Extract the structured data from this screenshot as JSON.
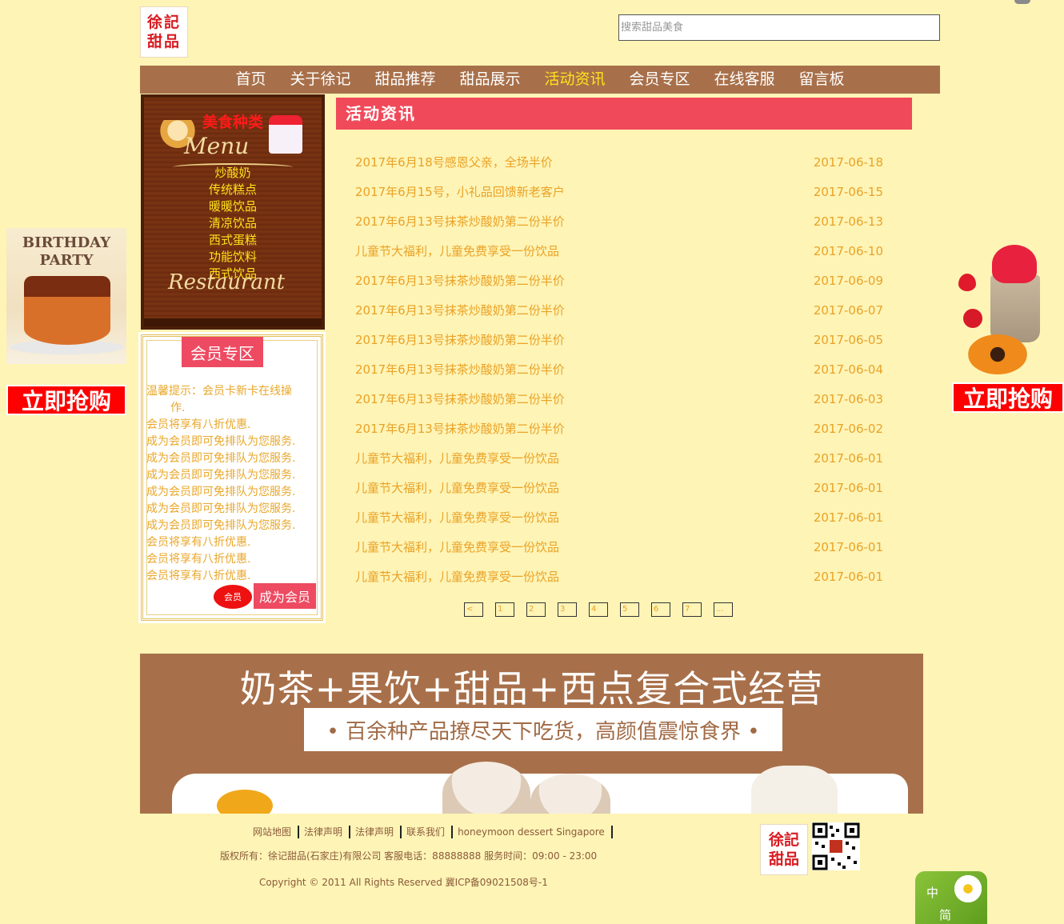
{
  "brand": {
    "logo_text": "徐记甜品"
  },
  "search": {
    "placeholder": "搜索甜品美食"
  },
  "nav": {
    "items": [
      {
        "label": "首页",
        "active": false
      },
      {
        "label": "关于徐记",
        "active": false
      },
      {
        "label": "甜品推荐",
        "active": false
      },
      {
        "label": "甜品展示",
        "active": false
      },
      {
        "label": "活动资讯",
        "active": true
      },
      {
        "label": "会员专区",
        "active": false
      },
      {
        "label": "在线客服",
        "active": false
      },
      {
        "label": "留言板",
        "active": false
      }
    ]
  },
  "menu_board": {
    "title": "美食种类",
    "script_top": "Menu",
    "script_bottom": "Restaurant",
    "items": [
      "炒酸奶",
      "传统糕点",
      "暖暖饮品",
      "清凉饮品",
      "西式蛋糕",
      "功能饮料",
      "西式饮品"
    ]
  },
  "member": {
    "title": "会员专区",
    "lines": [
      "温馨提示：会员卡新卡在线操",
      "作.",
      "会员将享有八折优惠.",
      "成为会员即可免排队为您服务.",
      "成为会员即可免排队为您服务.",
      "成为会员即可免排队为您服务.",
      "成为会员即可免排队为您服务.",
      "成为会员即可免排队为您服务.",
      "成为会员即可免排队为您服务.",
      "会员将享有八折优惠.",
      "会员将享有八折优惠.",
      "会员将享有八折优惠."
    ],
    "badge": "会员",
    "button": "成为会员"
  },
  "news": {
    "header": "活动资讯",
    "items": [
      {
        "title": "2017年6月18号感恩父亲，全场半价",
        "date": "2017-06-18"
      },
      {
        "title": "2017年6月15号，小礼品回馈新老客户",
        "date": "2017-06-15"
      },
      {
        "title": "2017年6月13号抹茶炒酸奶第二份半价",
        "date": "2017-06-13"
      },
      {
        "title": "儿童节大福利，儿童免费享受一份饮品",
        "date": "2017-06-10"
      },
      {
        "title": "2017年6月13号抹茶炒酸奶第二份半价",
        "date": "2017-06-09"
      },
      {
        "title": "2017年6月13号抹茶炒酸奶第二份半价",
        "date": "2017-06-07"
      },
      {
        "title": "2017年6月13号抹茶炒酸奶第二份半价",
        "date": "2017-06-05"
      },
      {
        "title": "2017年6月13号抹茶炒酸奶第二份半价",
        "date": "2017-06-04"
      },
      {
        "title": "2017年6月13号抹茶炒酸奶第二份半价",
        "date": "2017-06-03"
      },
      {
        "title": "2017年6月13号抹茶炒酸奶第二份半价",
        "date": "2017-06-02"
      },
      {
        "title": "儿童节大福利，儿童免费享受一份饮品",
        "date": "2017-06-01"
      },
      {
        "title": "儿童节大福利，儿童免费享受一份饮品",
        "date": "2017-06-01"
      },
      {
        "title": "儿童节大福利，儿童免费享受一份饮品",
        "date": "2017-06-01"
      },
      {
        "title": "儿童节大福利，儿童免费享受一份饮品",
        "date": "2017-06-01"
      },
      {
        "title": "儿童节大福利，儿童免费享受一份饮品",
        "date": "2017-06-01"
      }
    ]
  },
  "pager": [
    "<",
    "1",
    "2",
    "3",
    "4",
    "5",
    "6",
    "7",
    "..."
  ],
  "ads": {
    "left_title": "BIRTHDAY PARTY",
    "buy_label": "立即抢购"
  },
  "banner": {
    "title": "奶茶+果饮+甜品+西点复合式经营",
    "subtitle": "• 百余种产品撩尽天下吃货，高颜值震惊食界 •"
  },
  "footer": {
    "links": [
      "网站地图",
      "法律声明",
      "法律声明",
      "联系我们",
      "honeymoon dessert Singapore"
    ],
    "copy1": "版权所有：徐记甜品(石家庄)有限公司 客服电话：88888888 服务时间：09:00 - 23:00",
    "copy2": "Copyright © 2011 All Rights Reserved 冀ICP备09021508号-1"
  },
  "lang": {
    "line1": "中",
    "line2": "简"
  },
  "colors": {
    "background": "#fef4b6",
    "nav": "#a8704a",
    "nav_active": "#ffe31e",
    "accent_red": "#f04a5a",
    "news_text": "#eaa226"
  }
}
